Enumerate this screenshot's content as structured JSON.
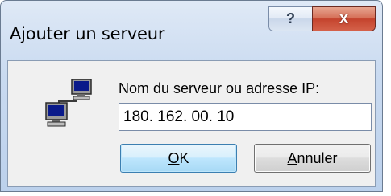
{
  "dialog": {
    "title": "Ajouter un serveur",
    "help_glyph": "?",
    "close_glyph": "x"
  },
  "form": {
    "label": "Nom du serveur ou adresse IP:",
    "ip_value": "180. 162. 00. 10"
  },
  "buttons": {
    "ok_mnemonic": "O",
    "ok_rest": "K",
    "cancel_mnemonic": "A",
    "cancel_rest": "nnuler"
  },
  "icons": {
    "network": "network-computers-icon",
    "help": "help-icon",
    "close": "close-icon"
  },
  "colors": {
    "close_button": "#c4432d",
    "ok_border": "#3c7fb1"
  }
}
